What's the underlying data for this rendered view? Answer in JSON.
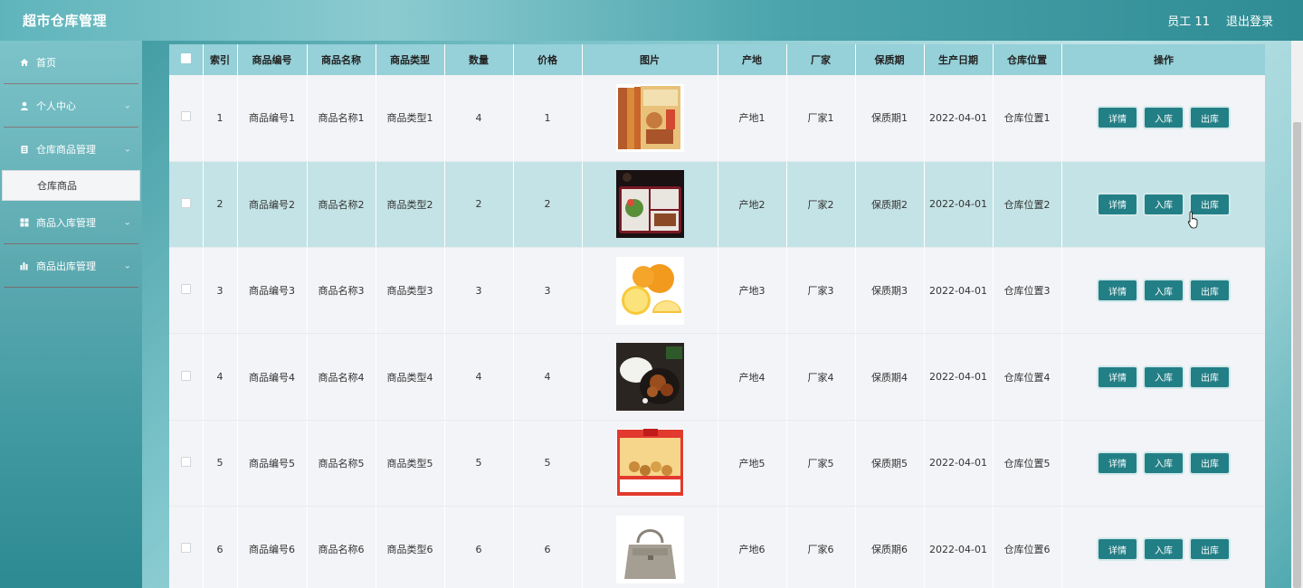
{
  "header": {
    "title": "超市仓库管理",
    "user": "员工 11",
    "logout": "退出登录"
  },
  "sidebar": {
    "items": [
      {
        "label": "首页",
        "icon": "home-icon"
      },
      {
        "label": "个人中心",
        "icon": "user-icon"
      },
      {
        "label": "仓库商品管理",
        "icon": "clipboard-icon"
      },
      {
        "label": "商品入库管理",
        "icon": "grid-icon"
      },
      {
        "label": "商品出库管理",
        "icon": "bar-chart-icon"
      }
    ],
    "submenu": {
      "label": "仓库商品"
    }
  },
  "table": {
    "columns": [
      "索引",
      "商品编号",
      "商品名称",
      "商品类型",
      "数量",
      "价格",
      "图片",
      "产地",
      "厂家",
      "保质期",
      "生产日期",
      "仓库位置",
      "操作"
    ],
    "actions": {
      "detail": "详情",
      "in": "入库",
      "out": "出库"
    },
    "rows": [
      {
        "idx": "1",
        "code": "商品编号1",
        "name": "商品名称1",
        "type": "商品类型1",
        "qty": "4",
        "price": "1",
        "image": "book-box-image",
        "origin": "产地1",
        "maker": "厂家1",
        "shelf": "保质期1",
        "date": "2022-04-01",
        "loc": "仓库位置1"
      },
      {
        "idx": "2",
        "code": "商品编号2",
        "name": "商品名称2",
        "type": "商品类型2",
        "qty": "2",
        "price": "2",
        "image": "bento-box-image",
        "origin": "产地2",
        "maker": "厂家2",
        "shelf": "保质期2",
        "date": "2022-04-01",
        "loc": "仓库位置2"
      },
      {
        "idx": "3",
        "code": "商品编号3",
        "name": "商品名称3",
        "type": "商品类型3",
        "qty": "3",
        "price": "3",
        "image": "oranges-image",
        "origin": "产地3",
        "maker": "厂家3",
        "shelf": "保质期3",
        "date": "2022-04-01",
        "loc": "仓库位置3"
      },
      {
        "idx": "4",
        "code": "商品编号4",
        "name": "商品名称4",
        "type": "商品类型4",
        "qty": "4",
        "price": "4",
        "image": "chicken-dish-image",
        "origin": "产地4",
        "maker": "厂家4",
        "shelf": "保质期4",
        "date": "2022-04-01",
        "loc": "仓库位置4"
      },
      {
        "idx": "5",
        "code": "商品编号5",
        "name": "商品名称5",
        "type": "商品类型5",
        "qty": "5",
        "price": "5",
        "image": "snack-box-image",
        "origin": "产地5",
        "maker": "厂家5",
        "shelf": "保质期5",
        "date": "2022-04-01",
        "loc": "仓库位置5"
      },
      {
        "idx": "6",
        "code": "商品编号6",
        "name": "商品名称6",
        "type": "商品类型6",
        "qty": "6",
        "price": "6",
        "image": "handbag-image",
        "origin": "产地6",
        "maker": "厂家6",
        "shelf": "保质期6",
        "date": "2022-04-01",
        "loc": "仓库位置6"
      }
    ]
  },
  "colors": {
    "accent": "#237f86",
    "header_row": "#96d0d8",
    "hover_row": "#c4e3e6"
  }
}
